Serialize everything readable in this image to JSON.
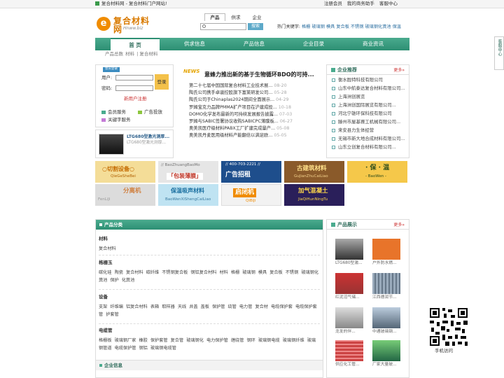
{
  "topbar": {
    "site": "复合材料网 - 复合材料门户网站!",
    "links": [
      "注册会员",
      "我的商务助手",
      "客服中心"
    ]
  },
  "logo": {
    "mark": "e",
    "name": "复合材料网",
    "sub": "Hnww.biz"
  },
  "search": {
    "tabs": [
      "产品",
      "供求",
      "企业"
    ],
    "button": "搜索",
    "hot_label": "热门关键字:",
    "hot": [
      "格栅",
      "玻璃钢",
      "模具",
      "复合板",
      "不锈钢",
      "玻璃钢化粪池",
      "保温"
    ]
  },
  "nav": {
    "items": [
      "首 页",
      "供求信息",
      "产品信息",
      "企业目录",
      "商业资讯"
    ]
  },
  "breadcrumb": [
    "产品总数",
    "材料",
    "复合材料"
  ],
  "login": {
    "tag": "会员登录",
    "user_label": "用户:",
    "pass_label": "密码:",
    "button": "登录",
    "register": "新用户注册",
    "services": [
      "会员服务",
      "广告投放",
      "关键字服务"
    ]
  },
  "promo": {
    "title": "LTG680型激光测厚...",
    "sub": "LTG680型激光测厚..."
  },
  "news": {
    "logo": "NEWS",
    "headline": "意蜂力推出新的基于生物循环BDO的可持...",
    "items": [
      {
        "t": "第二十七届中国国际复合材料工业技术展...",
        "d": "08-20"
      },
      {
        "t": "陶氏公司携手卓骏控股旗下富莱研发公司...",
        "d": "05-28"
      },
      {
        "t": "陶氏公司于Chinaplas2024期间全面展示...",
        "d": "04-29"
      },
      {
        "t": "罗姆宝克力品牌PMMA扩产项目在沪建成投...",
        "d": "10-18"
      },
      {
        "t": "DOMO化学发布最新的可持续发展报告披露...",
        "d": "07-03"
      },
      {
        "t": "罗姆与SABIC签署协议收购SABICPC薄膜板...",
        "d": "06-27"
      },
      {
        "t": "奥美凯医疗级材料PABX工厂扩建完成量产...",
        "d": "05-08"
      },
      {
        "t": "奥美凯丹麦医用级材料产能翻倍以满足欧...",
        "d": "05-05"
      }
    ]
  },
  "recommend": {
    "title": "企业推荐",
    "more": "更多»",
    "items": [
      "衡水胜特科技有限公司",
      "山东中航泰达复合材料有限公司...",
      "上海洲创展览",
      "上海洲创国际展览有限公司...",
      "河北宁雄环保科技有限公司",
      "滕州市屋基赛工机械有限公司...",
      "来安县力生体经营",
      "无锡市新大地合成材料有限公司...",
      "山东立创复合材料有限公司..."
    ]
  },
  "ads": [
    {
      "t": "○切割设备○",
      "s": "QieGeSheBei"
    },
    {
      "t": "「包装薄膜」",
      "s": "// BaoZhuangBaoMo"
    },
    {
      "t": "广告招租",
      "s": "// 400-703-2221 //"
    },
    {
      "t": "古建筑材料",
      "s": "GuJianZhuCaiLiao"
    },
    {
      "t": "· 保 · 温",
      "s": "- BaoWen -"
    },
    {
      "t": "分离机",
      "s": "FenLiJi"
    },
    {
      "t": "保温吸声材料",
      "s": "BaoWenXiShengCaiLiao"
    },
    {
      "t": "启闭机",
      "s": "QiBiJi"
    },
    {
      "t": "加气混凝土",
      "s": "JiaQiHunNingTu"
    }
  ],
  "categories": {
    "title": "产品分类",
    "groups": [
      {
        "name": "材料",
        "items": [
          "复合材料"
        ]
      },
      {
        "name": "格栅玉",
        "items": [
          "碳化硅",
          "陶瓷",
          "复合材料",
          "碳纤维",
          "不锈钢复合板",
          "钢铝复合材料",
          "材料",
          "格栅",
          "玻璃钢",
          "模具",
          "复合板",
          "不锈钢",
          "玻璃钢化粪池",
          "保护",
          "化粪池"
        ]
      },
      {
        "name": "设备",
        "items": [
          "支架",
          "纤维编",
          "铝复合材料",
          "表箱",
          "取样器",
          "天线",
          "井盖",
          "盖板",
          "保护管",
          "绕管",
          "电力管",
          "复合材",
          "电缆保护套",
          "电缆保护套管",
          "护套管"
        ]
      },
      {
        "name": "电缆管",
        "items": [
          "格栅板",
          "玻璃钢厂家",
          "橡胶",
          "保护套管",
          "复合管",
          "玻璃钢化",
          "电力保护管",
          "缠绕管",
          "钢环",
          "玻璃钢电缆",
          "玻璃钢纤维",
          "玻璃钢管道",
          "电缆保护管",
          "钢铝",
          "玻璃钢电缆管"
        ]
      }
    ]
  },
  "enterprise": {
    "title": "企业信息"
  },
  "products": {
    "title": "产品展示",
    "more": "更多»",
    "items": [
      "LTG680型激...",
      "户外防水燃...",
      "红泥沼气储...",
      "江西德润节...",
      "龙发的伴...",
      "中通玻璃钢...",
      "供应化工管...",
      "厂家大量玻..."
    ]
  },
  "sidebar": {
    "text": "客服中心"
  },
  "qr": {
    "label": "手机访问"
  },
  "colors": {
    "brand": "#2d8f73",
    "accent": "#f08c00",
    "link": "#2a6ea0"
  }
}
